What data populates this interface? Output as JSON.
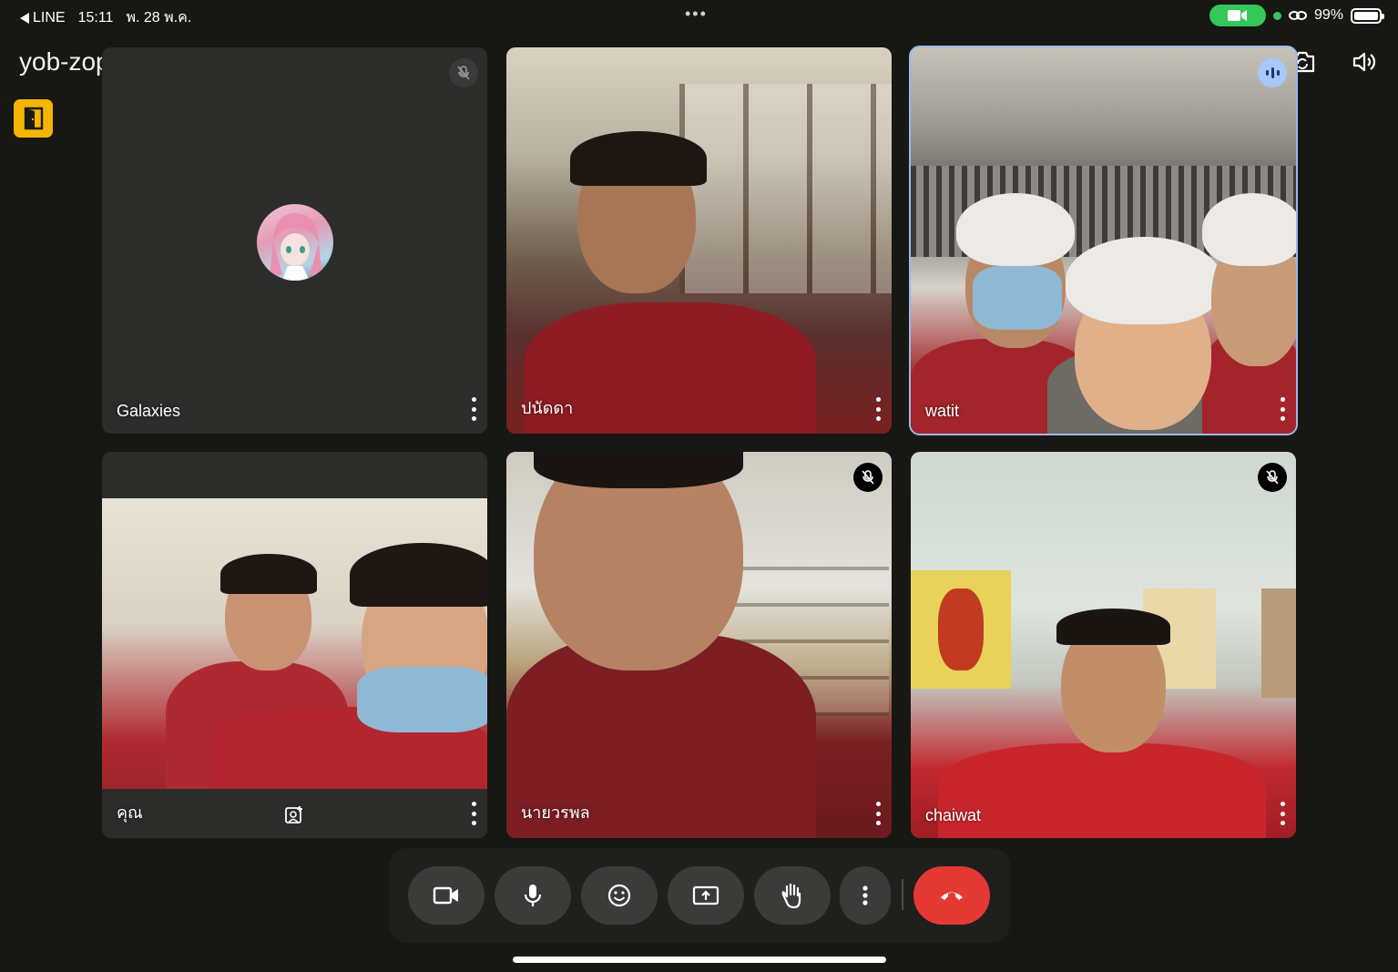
{
  "status_bar": {
    "back_app": "LINE",
    "time": "15:11",
    "date": "พ. 28 พ.ค.",
    "battery_percent": "99%",
    "battery_level": 0.99
  },
  "meeting": {
    "code": "yob-zopp-gna"
  },
  "tiles": [
    {
      "name": "Galaxies",
      "muted": true,
      "type": "avatar"
    },
    {
      "name": "ปนัดดา",
      "muted": false,
      "type": "video"
    },
    {
      "name": "watit",
      "muted": false,
      "speaking": true,
      "type": "video"
    },
    {
      "name": "คุณ",
      "muted": false,
      "type": "self"
    },
    {
      "name": "นายวรพล",
      "muted": true,
      "type": "video"
    },
    {
      "name": "chaiwat",
      "muted": true,
      "type": "video"
    }
  ],
  "controls": [
    {
      "icon": "camera-icon"
    },
    {
      "icon": "microphone-icon"
    },
    {
      "icon": "emoji-icon"
    },
    {
      "icon": "present-screen-icon"
    },
    {
      "icon": "raise-hand-icon"
    },
    {
      "icon": "more-options-icon"
    },
    {
      "icon": "end-call-icon"
    }
  ],
  "colors": {
    "background": "#171713",
    "tile": "#2c2d2b",
    "active_outline": "#9eb8e6",
    "end_call": "#e53935",
    "door_button": "#f4b400",
    "status_green": "#35c759"
  }
}
